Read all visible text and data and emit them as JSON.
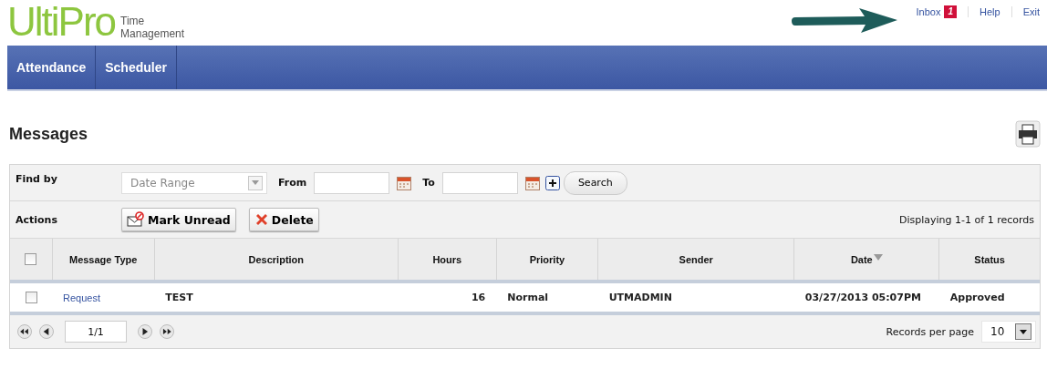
{
  "header": {
    "logo": "UltiPro",
    "product_lines": [
      "Time",
      "Management"
    ],
    "links": [
      {
        "label": "Inbox",
        "badge": "1"
      },
      {
        "label": "Help"
      },
      {
        "label": "Exit"
      }
    ]
  },
  "nav": {
    "tabs": [
      {
        "label": "Attendance"
      },
      {
        "label": "Scheduler"
      }
    ]
  },
  "page_title": "Messages",
  "filter": {
    "label": "Find by",
    "type_select": {
      "placeholder": "Date Range"
    },
    "from_label": "From",
    "to_label": "To",
    "search_button": "Search"
  },
  "actions": {
    "label": "Actions",
    "buttons": [
      {
        "kind": "mark-unread",
        "label": "Mark Unread"
      },
      {
        "kind": "delete",
        "label": "Delete"
      }
    ],
    "summary": "Displaying 1-1 of 1 records"
  },
  "table": {
    "select_all": {
      "checked": false
    },
    "columns": [
      {
        "kind": "link",
        "label": "Message Type"
      },
      {
        "kind": "text",
        "label": "Description"
      },
      {
        "kind": "number",
        "label": "Hours"
      },
      {
        "kind": "text",
        "label": "Priority"
      },
      {
        "kind": "text",
        "label": "Sender"
      },
      {
        "kind": "text",
        "label": "Date",
        "sorted": true
      },
      {
        "kind": "text",
        "label": "Status"
      }
    ],
    "rows": [
      {
        "checked": false,
        "cells": [
          "Request",
          "TEST",
          "16",
          "Normal",
          "UTMADMIN",
          "03/27/2013 05:07PM",
          "Approved"
        ]
      }
    ]
  },
  "pager": {
    "page": "1/1",
    "records_label": "Records per page",
    "per_page": "10"
  }
}
